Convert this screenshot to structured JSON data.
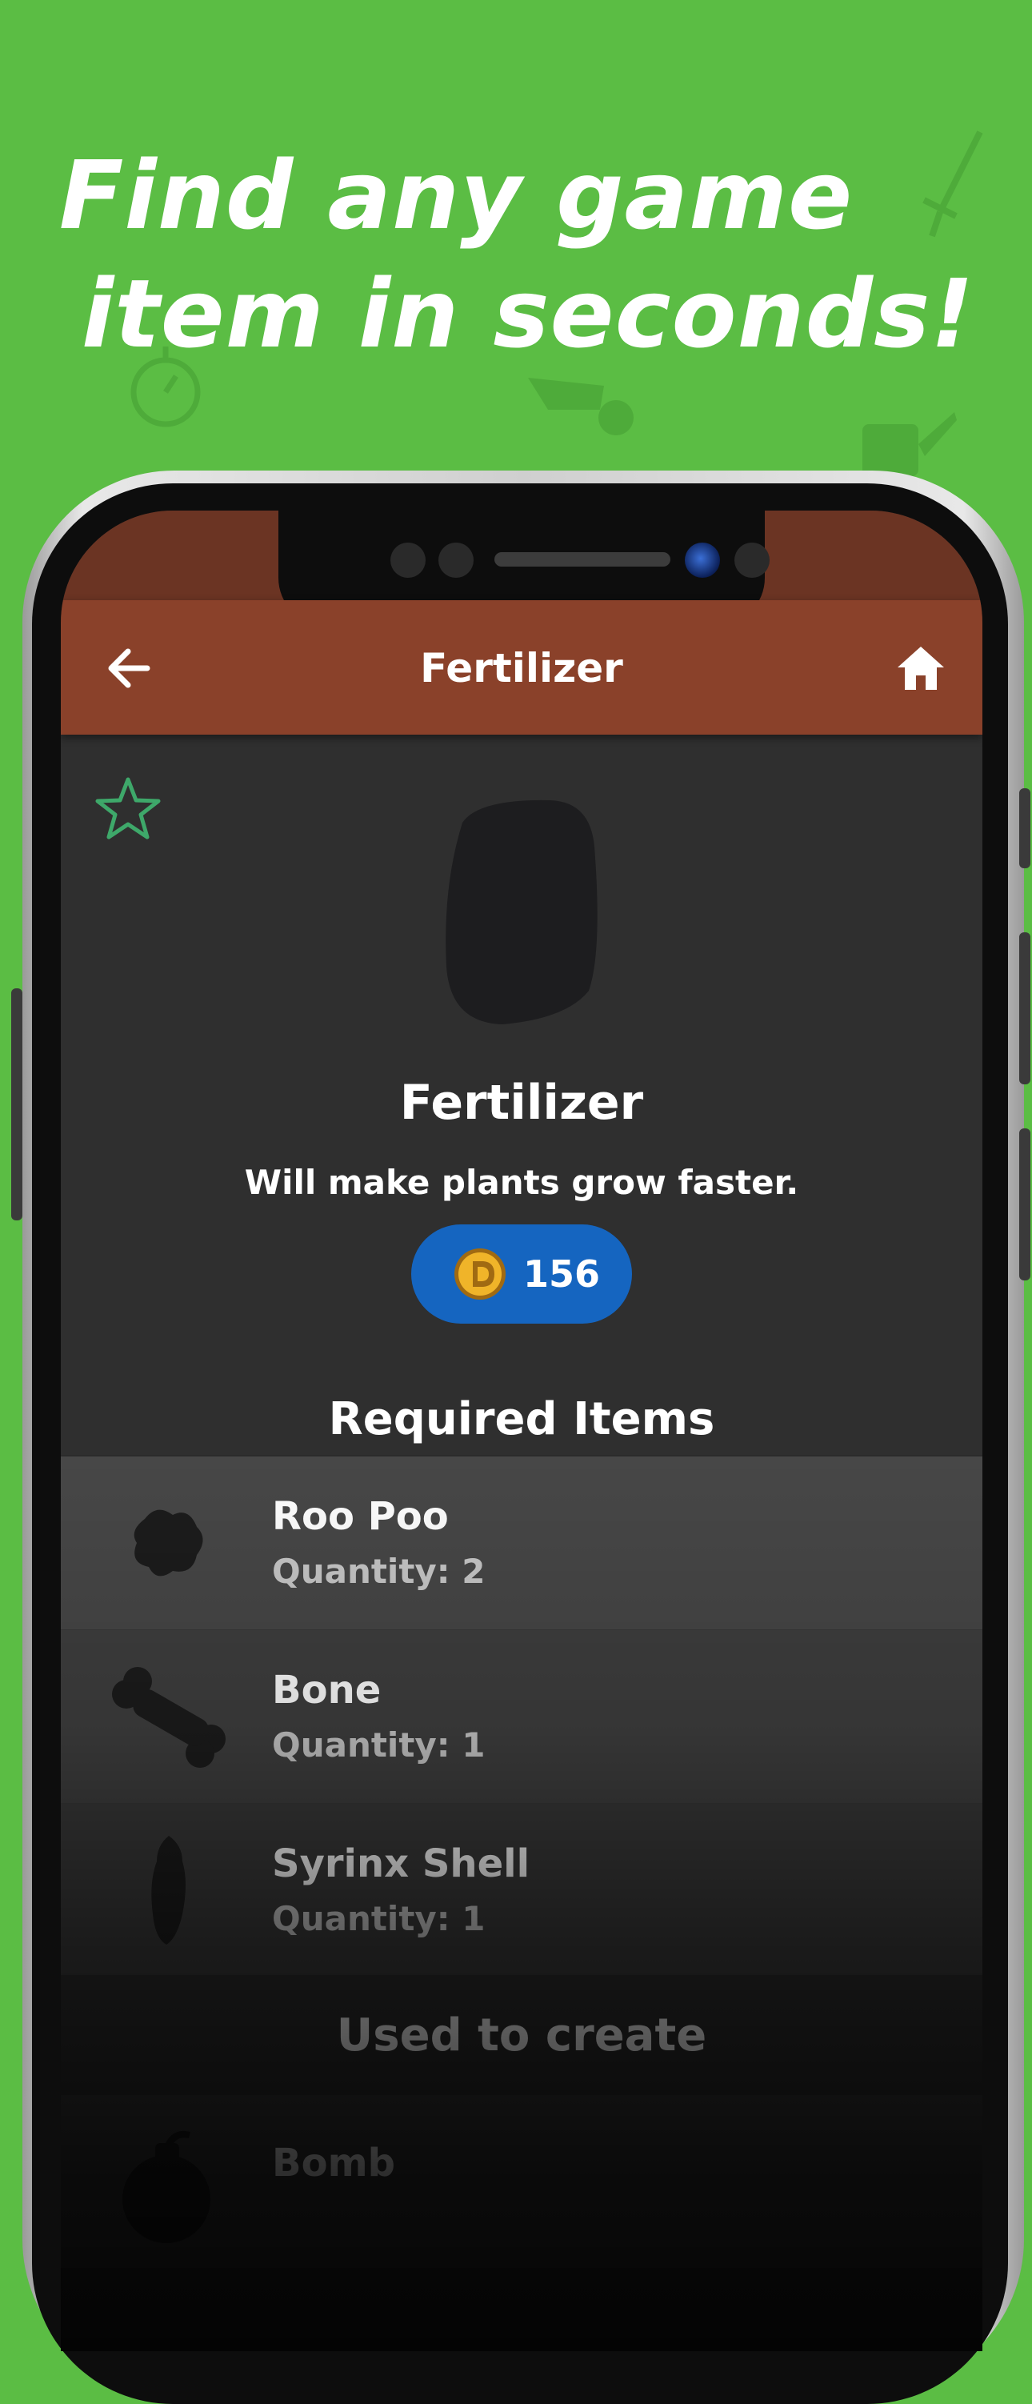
{
  "promo": {
    "headline_line1": "Find any game",
    "headline_line2": "item in seconds!"
  },
  "appbar": {
    "title": "Fertilizer",
    "back_icon": "arrow-left-icon",
    "home_icon": "home-icon"
  },
  "item": {
    "name": "Fertilizer",
    "description": "Will make plants grow faster.",
    "price": "156",
    "favorite_icon": "star-outline-icon",
    "coin_icon": "coin-icon"
  },
  "required": {
    "title": "Required Items",
    "items": [
      {
        "name": "Roo Poo",
        "quantity": "Quantity: 2"
      },
      {
        "name": "Bone",
        "quantity": "Quantity: 1"
      },
      {
        "name": "Syrinx Shell",
        "quantity": "Quantity: 1"
      }
    ]
  },
  "used_to_create": {
    "title": "Used to create",
    "items": [
      {
        "name": "Bomb"
      }
    ]
  },
  "colors": {
    "background": "#5bbd44",
    "appbar": "#8a412a",
    "price_pill": "#1565c0",
    "favorite_star": "#3ea86a"
  }
}
